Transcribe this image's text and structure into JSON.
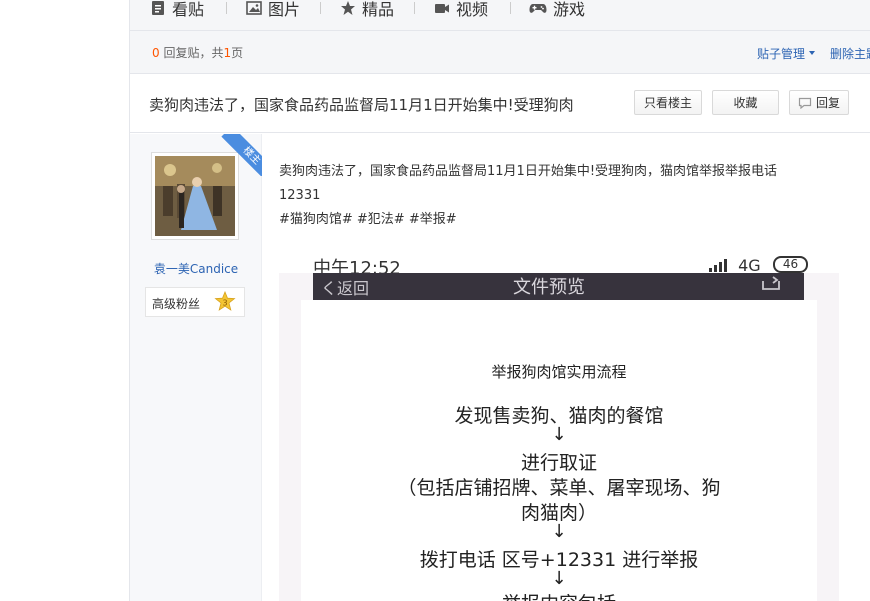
{
  "nav": {
    "tabs": [
      {
        "label": "看贴",
        "icon": "document-icon"
      },
      {
        "label": "图片",
        "icon": "image-icon"
      },
      {
        "label": "精品",
        "icon": "star-icon"
      },
      {
        "label": "视频",
        "icon": "video-icon"
      },
      {
        "label": "游戏",
        "icon": "gamepad-icon"
      }
    ]
  },
  "stats": {
    "reply_count": "0",
    "reply_text": " 回复贴，共",
    "page_count": "1",
    "page_text": "页",
    "manage_label": "贴子管理",
    "delete_label": "删除主题"
  },
  "thread": {
    "title": "卖狗肉违法了，国家食品药品监督局11月1日开始集中!受理狗肉",
    "only_op_label": "只看楼主",
    "favorite_label": "收藏",
    "reply_label": "回复"
  },
  "author": {
    "name": "袁一美Candice",
    "badge_label": "高级粉丝",
    "level": "3",
    "op_ribbon": "楼主"
  },
  "post": {
    "line1": "卖狗肉违法了，国家食品药品监督局11月1日开始集中!受理狗肉，猫肉馆举报举报电话",
    "line2": "12331",
    "line3": "#猫狗肉馆# #犯法# #举报#"
  },
  "image": {
    "time": "中午12:52",
    "network": "4G",
    "battery": "46",
    "back": "く返回",
    "page_title": "文件预览",
    "flow_heading": "举报狗肉馆实用流程",
    "step1": "发现售卖狗、猫肉的餐馆",
    "arrow": "↓",
    "step2": "进行取证",
    "step2_detail_1": "（包括店铺招牌、菜单、屠宰现场、狗",
    "step2_detail_2": "肉猫肉）",
    "step3": "拨打电话  区号+12331  进行举报",
    "step4": "举报内容包括"
  },
  "colors": {
    "link": "#2d64b3",
    "accent_orange": "#ff5500",
    "ribbon_blue": "#4b8de0",
    "nav_bg": "#f5f6f8"
  }
}
